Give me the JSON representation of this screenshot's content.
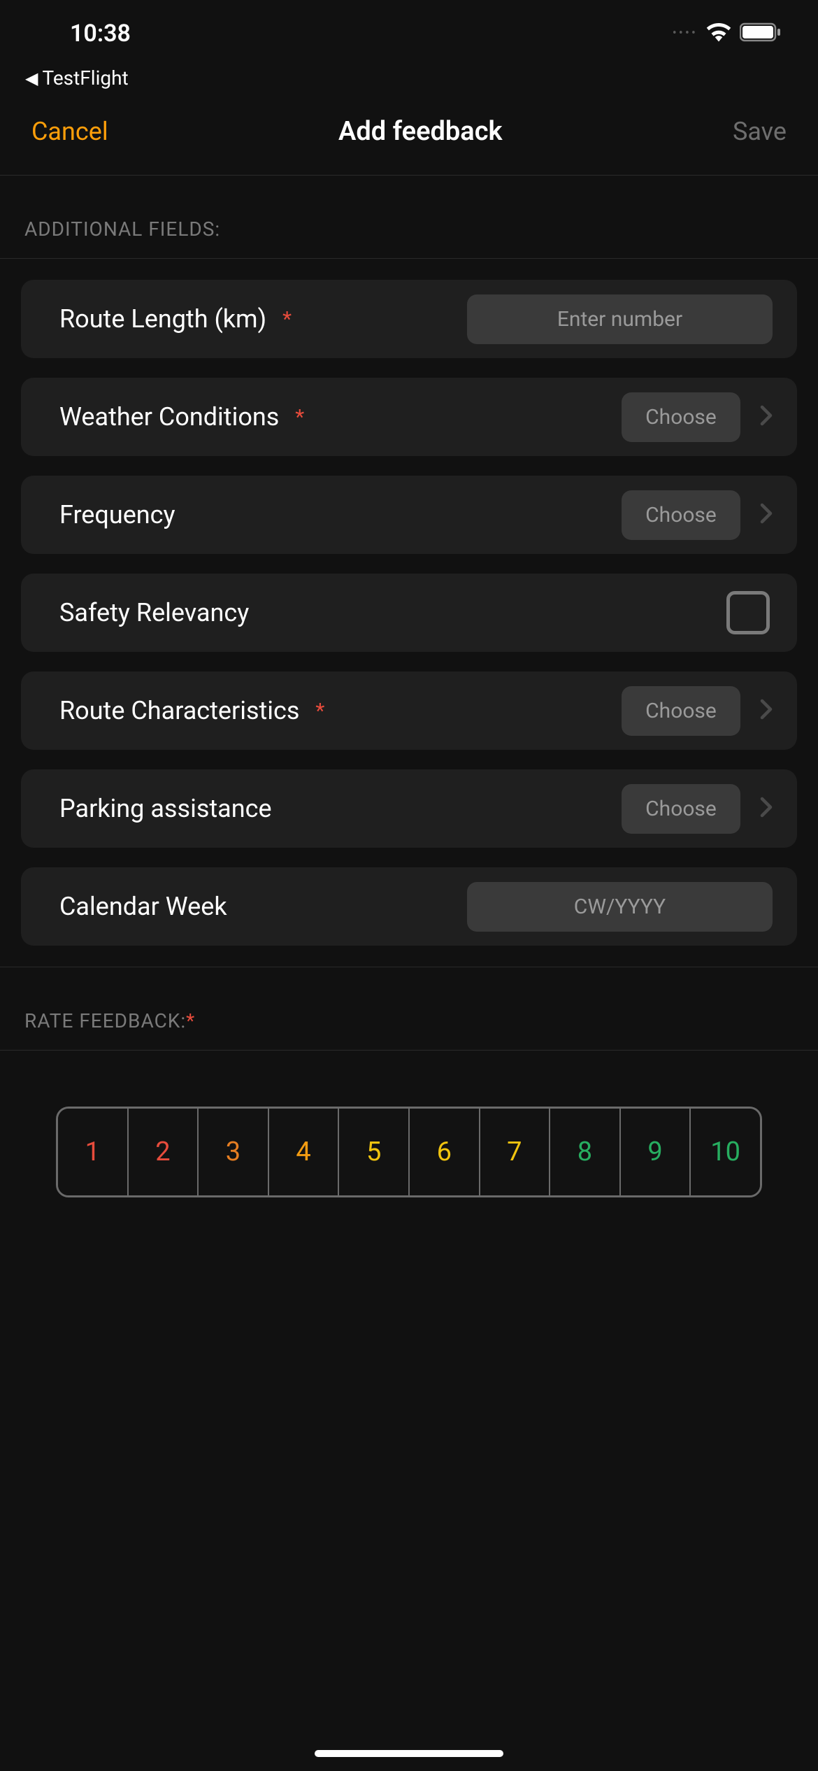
{
  "status": {
    "time": "10:38",
    "back_app": "TestFlight"
  },
  "nav": {
    "cancel": "Cancel",
    "title": "Add feedback",
    "save": "Save"
  },
  "section_additional": "ADDITIONAL FIELDS:",
  "fields": {
    "route_length": {
      "label": "Route Length (km)",
      "required": "*",
      "placeholder": "Enter number"
    },
    "weather": {
      "label": "Weather Conditions",
      "required": "*",
      "btn": "Choose"
    },
    "frequency": {
      "label": "Frequency",
      "btn": "Choose"
    },
    "safety": {
      "label": "Safety Relevancy"
    },
    "route_char": {
      "label": "Route Characteristics",
      "required": "*",
      "btn": "Choose"
    },
    "parking": {
      "label": "Parking assistance",
      "btn": "Choose"
    },
    "calendar_week": {
      "label": "Calendar Week",
      "placeholder": "CW/YYYY"
    }
  },
  "section_rate": "RATE FEEDBACK:",
  "section_rate_required": "*",
  "rating": {
    "values": [
      "1",
      "2",
      "3",
      "4",
      "5",
      "6",
      "7",
      "8",
      "9",
      "10"
    ],
    "colors": [
      "#e74c3c",
      "#e74c3c",
      "#e67e22",
      "#f39c12",
      "#f1c40f",
      "#f1c40f",
      "#f1c40f",
      "#27ae60",
      "#27ae60",
      "#27ae60"
    ]
  }
}
